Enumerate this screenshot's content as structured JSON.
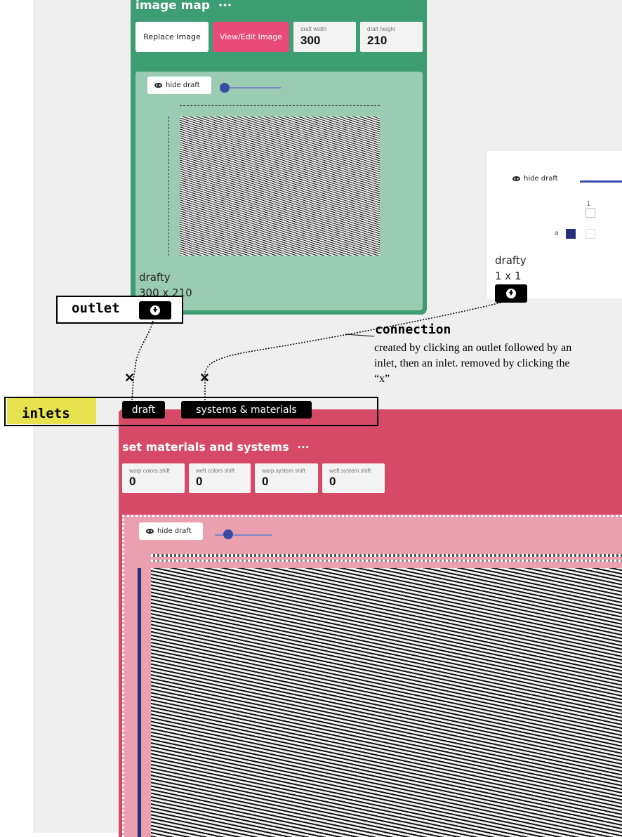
{
  "image_map": {
    "title": "image map",
    "more": "•••",
    "replace_label": "Replace Image",
    "view_edit_label": "View/Edit Image",
    "width_label": "draft width",
    "width_value": "300",
    "height_label": "draft height",
    "height_value": "210",
    "hide_label": "hide draft",
    "output_name": "drafty",
    "output_size": "300 x 210"
  },
  "drafty_node": {
    "hide_label": "hide draft",
    "col_number": "1",
    "row_label": "a",
    "name": "drafty",
    "size": "1 x 1"
  },
  "annotations": {
    "outlet": "outlet",
    "inlets": "inlets",
    "connection_title": "connection",
    "connection_desc_1": "created by clicking an outlet followed by an",
    "connection_desc_2": "inlet, then an inlet. removed by clicking the",
    "connection_desc_3": "“x”",
    "x_mark": "×"
  },
  "inlets": {
    "draft": "draft",
    "systems": "systems & materials"
  },
  "materials_node": {
    "title": "set materials and systems",
    "more": "•••",
    "params": [
      {
        "label": "warp colors shift",
        "value": "0"
      },
      {
        "label": "weft colors shift",
        "value": "0"
      },
      {
        "label": "warp system shift",
        "value": "0"
      },
      {
        "label": "weft system shift",
        "value": "0"
      }
    ],
    "hide_label": "hide draft"
  },
  "colors": {
    "green_node": "#3c9e72",
    "pink_node": "#d64a67",
    "accent_pink": "#e84a7a",
    "slider_blue": "#3a4aa7",
    "inlets_highlight": "#e6e34f"
  }
}
